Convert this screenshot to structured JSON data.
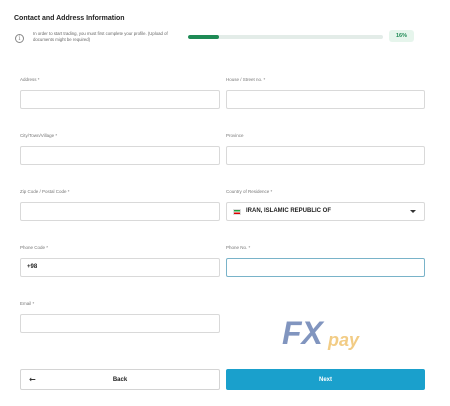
{
  "form": {
    "title": "Contact and Address Information",
    "info_text": "In order to start trading, you must first complete your profile. (Upload of documents might be required)",
    "progress": {
      "label": "16%",
      "value": 16
    }
  },
  "fields": {
    "address": {
      "label": "Address *",
      "value": ""
    },
    "house": {
      "label": "House / Street no. *",
      "value": ""
    },
    "city": {
      "label": "City/Town/Village *",
      "value": ""
    },
    "province": {
      "label": "Province",
      "value": ""
    },
    "zip": {
      "label": "Zip Code / Postal Code *",
      "value": ""
    },
    "country": {
      "label": "Country of Residence *",
      "value": "IRAN, ISLAMIC REPUBLIC OF"
    },
    "phone_code": {
      "label": "Phone Code *",
      "value": "+98"
    },
    "phone_no": {
      "label": "Phone No. *",
      "value": ""
    },
    "email": {
      "label": "Email *",
      "value": ""
    }
  },
  "buttons": {
    "back": "Back",
    "next": "Next"
  },
  "watermark": {
    "text_fx": "FX",
    "text_pay": "pay"
  },
  "icons": {
    "info": "info-circle-icon",
    "back_arrow": "arrow-left-icon",
    "select_caret": "caret-down-icon",
    "flag": "iran-flag-icon"
  },
  "colors": {
    "accent": "#1aa0cc",
    "progress": "#1e8a55",
    "watermark_fx": "#1c3f8c",
    "watermark_pay": "#e8a323"
  }
}
